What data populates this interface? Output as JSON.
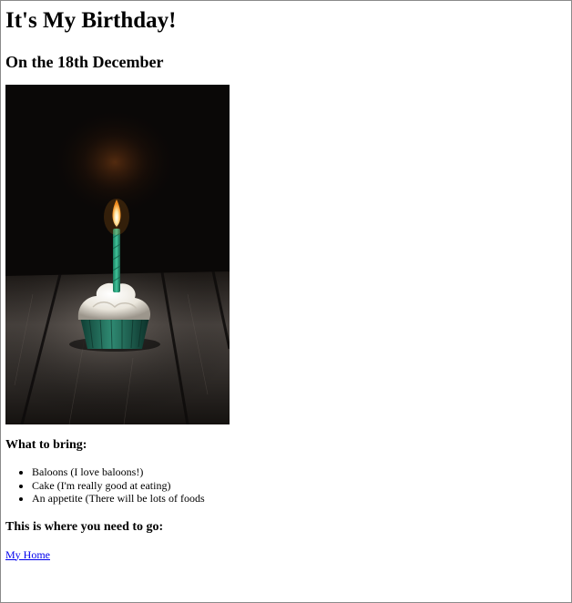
{
  "page": {
    "title": "It's My Birthday!",
    "subtitle": "On the 18th December",
    "bring_heading": "What to bring:",
    "bring_items": [
      "Baloons (I love baloons!)",
      "Cake (I'm really good at eating)",
      "An appetite (There will be lots of foods"
    ],
    "where_heading": "This is where you need to go:",
    "link_text": "My Home"
  },
  "colors": {
    "link": "#0000ee",
    "border": "#8a8a8a"
  },
  "icons": {
    "photo": "cupcake-candle-photo"
  }
}
